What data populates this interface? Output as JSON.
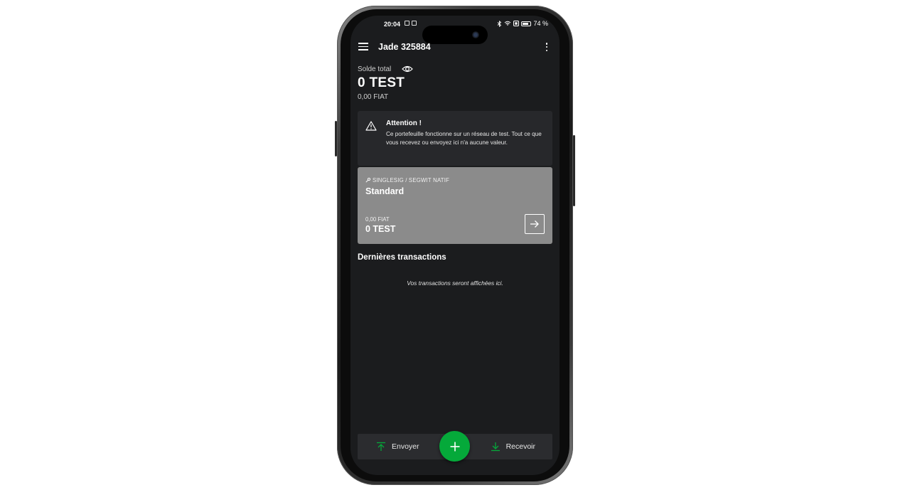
{
  "status_bar": {
    "time": "20:04",
    "battery": "74 %"
  },
  "app_bar": {
    "title": "Jade 325884",
    "menu_icon": "hamburger-menu-icon",
    "more_icon": "kebab-menu-icon"
  },
  "balance": {
    "label": "Solde total",
    "amount": "0 TEST",
    "fiat": "0,00 FIAT",
    "visibility_icon": "eye-icon"
  },
  "warning": {
    "title": "Attention !",
    "text": "Ce portefeuille fonctionne sur un réseau de test. Tout ce que vous recevez ou envoyez ici n'a aucune valeur.",
    "icon": "warning-triangle-icon"
  },
  "account": {
    "type": "SINGLESIG / SEGWIT NATIF",
    "name": "Standard",
    "fiat": "0,00 FIAT",
    "amount": "0 TEST",
    "background": "#8b8b8b"
  },
  "transactions": {
    "title": "Dernières transactions",
    "empty": "Vos transactions seront affichées ici."
  },
  "actions": {
    "send_label": "Envoyer",
    "receive_label": "Recevoir",
    "accent": "#05a93a"
  }
}
